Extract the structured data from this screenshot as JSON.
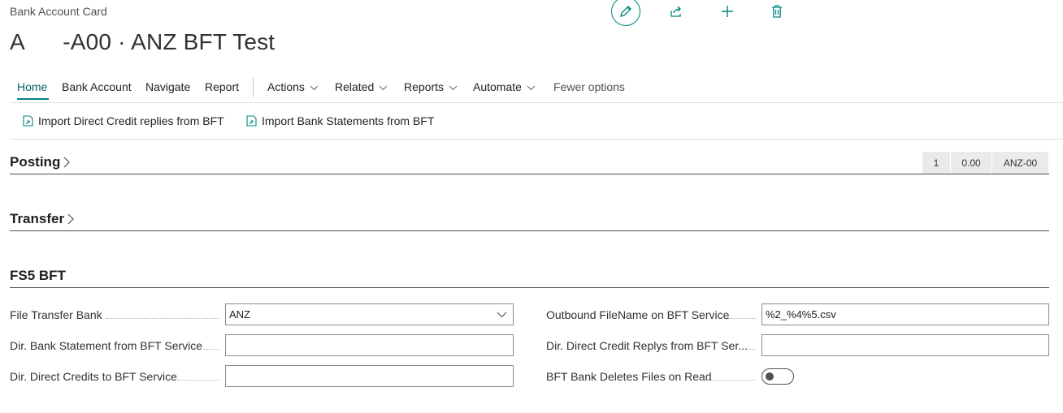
{
  "breadcrumb": "Bank Account Card",
  "page_title": "A      -A00 · ANZ BFT Test",
  "top_icons": [
    "pencil-icon",
    "share-icon",
    "plus-icon",
    "trash-icon"
  ],
  "menu": {
    "items": [
      "Home",
      "Bank Account",
      "Navigate",
      "Report"
    ],
    "dropdowns": [
      "Actions",
      "Related",
      "Reports",
      "Automate"
    ],
    "fewer_options": "Fewer options"
  },
  "actions": [
    "Import Direct Credit replies from BFT",
    "Import Bank Statements from BFT"
  ],
  "sections": {
    "posting": "Posting",
    "transfer": "Transfer",
    "fs5bft": "FS5 BFT"
  },
  "cues": [
    "1",
    "0.00",
    "ANZ-00"
  ],
  "fields": {
    "file_transfer_bank": {
      "label": "File Transfer Bank",
      "value": "ANZ"
    },
    "dir_bank_statement": {
      "label": "Dir. Bank Statement from BFT Service",
      "value": ""
    },
    "dir_direct_credits": {
      "label": "Dir. Direct Credits to BFT Service",
      "value": ""
    },
    "outbound_filename": {
      "label": "Outbound FileName on BFT Service",
      "value": "%2_%4%5.csv"
    },
    "dir_direct_credit_replys": {
      "label": "Dir. Direct Credit Replys from BFT Ser...",
      "value": ""
    },
    "bank_deletes_files": {
      "label": "BFT Bank Deletes Files on Read",
      "value": "off"
    }
  },
  "colors": {
    "accent": "#00857d",
    "text": "#212121"
  }
}
